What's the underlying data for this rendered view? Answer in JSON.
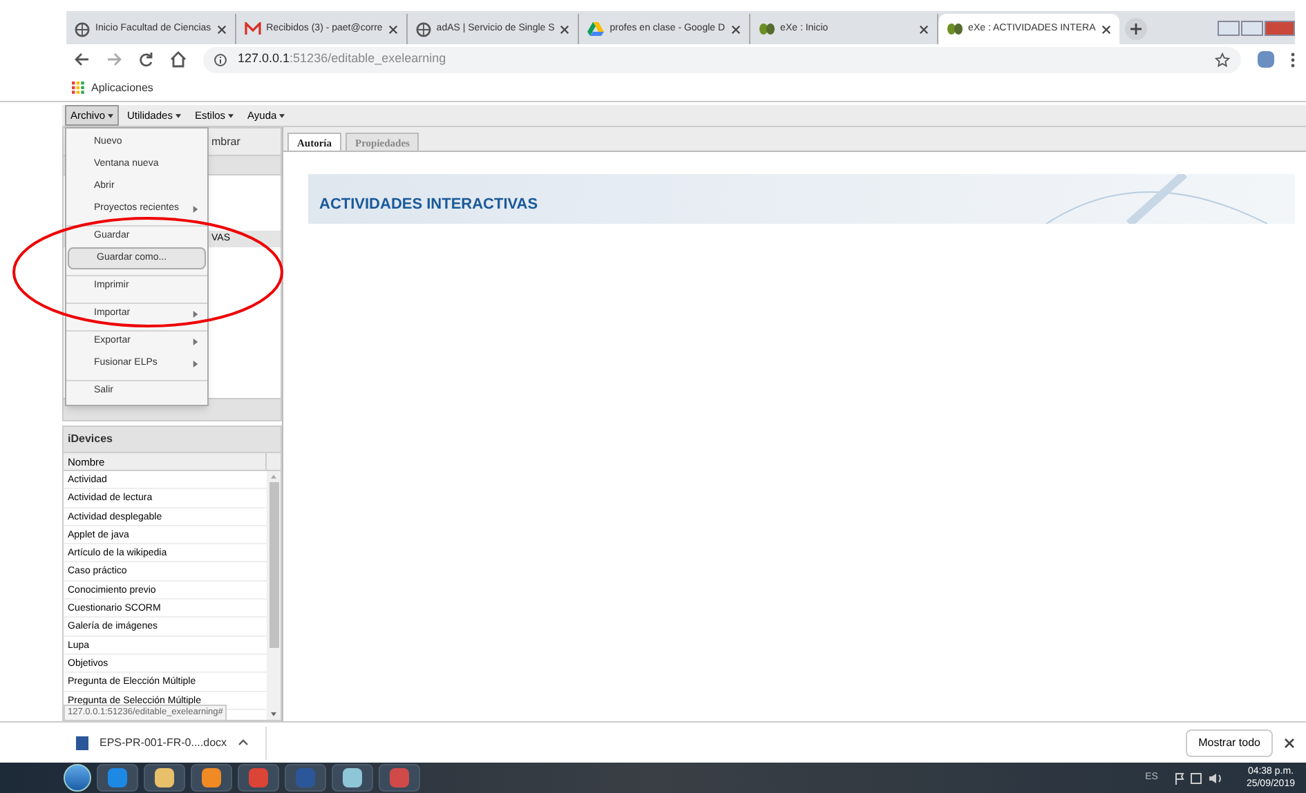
{
  "browser_tabs": [
    {
      "title": "Inicio Facultad de Ciencias",
      "kind": "globe",
      "selected": false
    },
    {
      "title": "Recibidos (3) - paet@corre",
      "kind": "mail",
      "selected": false
    },
    {
      "title": "adAS | Servicio de Single S",
      "kind": "globe",
      "selected": false
    },
    {
      "title": "profes en clase - Google D",
      "kind": "drive",
      "selected": false
    },
    {
      "title": "eXe : Inicio",
      "kind": "exe",
      "selected": false
    },
    {
      "title": "eXe : ACTIVIDADES INTERA",
      "kind": "exe",
      "selected": true
    }
  ],
  "address": {
    "host": "127.0.0.1",
    "path": ":51236/editable_exelearning"
  },
  "bookmarks": [
    {
      "label": "Aplicaciones"
    }
  ],
  "menubar": [
    {
      "label": "Archivo",
      "selected": true
    },
    {
      "label": "Utilidades",
      "selected": false
    },
    {
      "label": "Estilos",
      "selected": false
    },
    {
      "label": "Ayuda",
      "selected": false
    }
  ],
  "file_menu": [
    {
      "label": "Nuevo",
      "submenu": false,
      "separator_before": false,
      "selected": false
    },
    {
      "label": "Ventana nueva",
      "submenu": false,
      "separator_before": false,
      "selected": false
    },
    {
      "label": "Abrir",
      "submenu": false,
      "separator_before": false,
      "selected": false
    },
    {
      "label": "Proyectos recientes",
      "submenu": true,
      "separator_before": false,
      "selected": false
    },
    {
      "label": "Guardar",
      "submenu": false,
      "separator_before": true,
      "selected": false
    },
    {
      "label": "Guardar como...",
      "submenu": false,
      "separator_before": false,
      "selected": true
    },
    {
      "label": "Imprimir",
      "submenu": false,
      "separator_before": true,
      "selected": false
    },
    {
      "label": "Importar",
      "submenu": true,
      "separator_before": true,
      "selected": false
    },
    {
      "label": "Exportar",
      "submenu": true,
      "separator_before": true,
      "selected": false
    },
    {
      "label": "Fusionar ELPs",
      "submenu": true,
      "separator_before": false,
      "selected": false
    },
    {
      "label": "Salir",
      "submenu": false,
      "separator_before": true,
      "selected": false
    }
  ],
  "outline": {
    "toolbar_fragment": "mbrar",
    "node_fragment": "VAS"
  },
  "idevices": {
    "title": "iDevices",
    "column": "Nombre",
    "items": [
      "Actividad",
      "Actividad de lectura",
      "Actividad desplegable",
      "Applet de java",
      "Artículo de la wikipedia",
      "Caso práctico",
      "Conocimiento previo",
      "Cuestionario SCORM",
      "Galería de imágenes",
      "Lupa",
      "Objetivos",
      "Pregunta de Elección Múltiple",
      "Pregunta de Selección Múltiple"
    ]
  },
  "status_url": "127.0.0.1:51236/editable_exelearning#",
  "editor_tabs": [
    {
      "label": "Autoría",
      "selected": true
    },
    {
      "label": "Propiedades",
      "selected": false
    }
  ],
  "page_title": "ACTIVIDADES INTERACTIVAS",
  "download": {
    "file": "EPS-PR-001-FR-0....docx",
    "show_all": "Mostrar todo"
  },
  "taskbar": {
    "language": "ES",
    "time": "04:38 p.m.",
    "date": "25/09/2019"
  }
}
